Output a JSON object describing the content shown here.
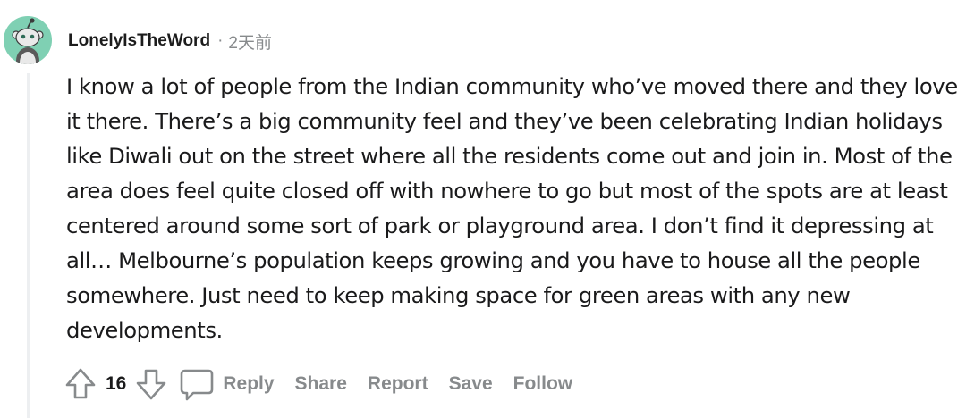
{
  "comment": {
    "author": "LonelyIsTheWord",
    "separator": "·",
    "time_ago": "2天前",
    "body": "I know a lot of people from the Indian community who’ve moved there and they love it there. There’s a big community feel and they’ve been celebrating Indian holidays like Diwali out on the street where all the residents come out and join in. Most of the area does feel quite closed off with nowhere to go but most of the spots are at least centered around some sort of park or playground area. I don’t find it depressing at all… Melbourne’s population keeps growing and you have to house all the people somewhere. Just need to keep making space for green areas with any new developments.",
    "vote_count": "16",
    "avatar_color": "#7fd0b3"
  },
  "actions": {
    "reply": "Reply",
    "share": "Share",
    "report": "Report",
    "save": "Save",
    "follow": "Follow"
  },
  "icons": {
    "upvote": "arrow-up-outline-icon",
    "downvote": "arrow-down-outline-icon",
    "reply": "speech-bubble-icon",
    "avatar": "snoo-avatar-icon"
  },
  "colors": {
    "meta_text": "#878a8c",
    "body_text": "#1a1a1b",
    "thread_line": "#edeff1"
  }
}
